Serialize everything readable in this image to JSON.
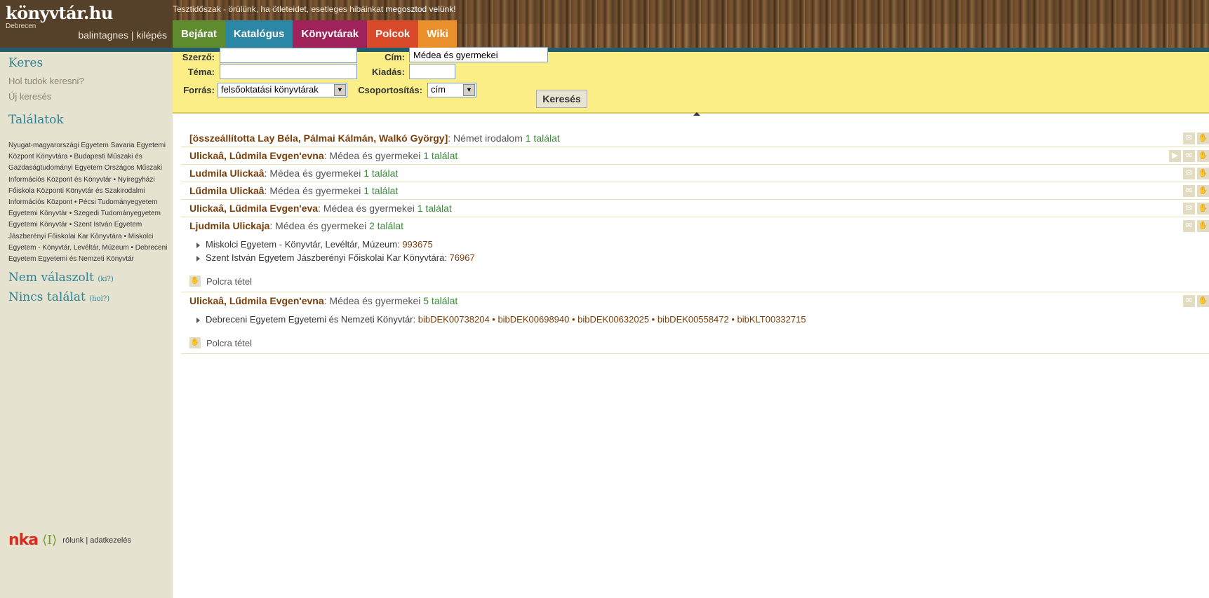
{
  "brand": {
    "logo": "könyvtár.hu",
    "city": "Debrecen",
    "user": "balintagnes",
    "separator": " | ",
    "logout": "kilépés"
  },
  "notice": {
    "prefix": "Tesztidőszak - örülünk, ha ötleteidet, esetleges hibáinkat ",
    "link": "megosztod velünk!"
  },
  "tabs": [
    {
      "label": "Bejárat"
    },
    {
      "label": "Katalógus"
    },
    {
      "label": "Könyvtárak"
    },
    {
      "label": "Polcok"
    },
    {
      "label": "Wiki"
    }
  ],
  "sidebar": {
    "search_title": "Keres",
    "where_link": "Hol tudok keresni?",
    "new_search": "Új keresés",
    "results_title": "Találatok",
    "results_libraries": "Nyugat-magyarországi Egyetem Savaria Egyetemi Központ Könyvtára • Budapesti Műszaki és Gazdaságtudományi Egyetem Országos Műszaki Információs Központ és Könyvtár • Nyíregyházi Főiskola Központi Könyvtár és Szakirodalmi Információs Központ • Pécsi Tudományegyetem Egyetemi Könyvtár • Szegedi Tudományegyetem Egyetemi Könyvtár • Szent István Egyetem Jászberényi Főiskolai Kar Könyvtára • Miskolci Egyetem - Könyvtár, Levéltár, Múzeum • Debreceni Egyetem Egyetemi és Nemzeti Könyvtár",
    "no_answer": "Nem válaszolt",
    "no_answer_hint": "(ki?)",
    "no_result": "Nincs találat",
    "no_result_hint": "(hol?)"
  },
  "footer": {
    "logo": "nka",
    "about": "rólunk",
    "sep": " | ",
    "privacy": "adatkezelés"
  },
  "search": {
    "author_label": "Szerző:",
    "author_value": "",
    "title_label": "Cím:",
    "title_value": "Médea és gyermekei",
    "topic_label": "Téma:",
    "topic_value": "",
    "publisher_label": "Kiadás:",
    "publisher_value": "",
    "source_label": "Forrás:",
    "source_value": "felsőoktatási könyvtárak",
    "group_label": "Csoportosítás:",
    "group_value": "cím",
    "button": "Keresés"
  },
  "results": [
    {
      "author": "[összeállította Lay Béla, Pálmai Kálmán, Walkó György]",
      "title": ": Német irodalom ",
      "hits": "1 találat",
      "icons": [
        "mail-icon",
        "hand-icon"
      ]
    },
    {
      "author": "Ulickaâ, Lûdmila Evgen'evna",
      "title": ": Médea és gyermekei ",
      "hits": "1 találat",
      "icons": [
        "play-icon",
        "mail-icon",
        "hand-icon"
      ]
    },
    {
      "author": "Ludmila Ulickaâ",
      "title": ": Médea és gyermekei ",
      "hits": "1 találat",
      "icons": [
        "mail-icon",
        "hand-icon"
      ]
    },
    {
      "author": "Lűdmila Ulickaâ",
      "title": ": Médea és gyermekei ",
      "hits": "1 találat",
      "icons": [
        "mail-icon",
        "hand-icon"
      ]
    },
    {
      "author": "Ulickaâ, Lűdmila Evgen'eva",
      "title": ": Médea és gyermekei ",
      "hits": "1 találat",
      "icons": [
        "mail-icon",
        "hand-icon"
      ]
    },
    {
      "author": "Ljudmila Ulickaja",
      "title": ": Médea és gyermekei ",
      "hits": "2 találat",
      "icons": [
        "mail-icon",
        "hand-icon"
      ],
      "holdings": [
        {
          "library": "Miskolci Egyetem - Könyvtár, Levéltár, Múzeum: ",
          "ids": "993675"
        },
        {
          "library": "Szent István Egyetem Jászberényi Főiskolai Kar Könyvtára: ",
          "ids": "76967"
        }
      ],
      "shelf": "Polcra tétel"
    },
    {
      "author": "Ulickaâ, Lűdmila Evgen'evna",
      "title": ": Médea és gyermekei ",
      "hits": "5 találat",
      "icons": [
        "mail-icon",
        "hand-icon"
      ],
      "holdings": [
        {
          "library": "Debreceni Egyetem Egyetemi és Nemzeti Könyvtár: ",
          "ids": "bibDEK00738204 • bibDEK00698940 • bibDEK00632025 • bibDEK00558472 • bibKLT00332715"
        }
      ],
      "shelf": "Polcra tétel"
    }
  ]
}
